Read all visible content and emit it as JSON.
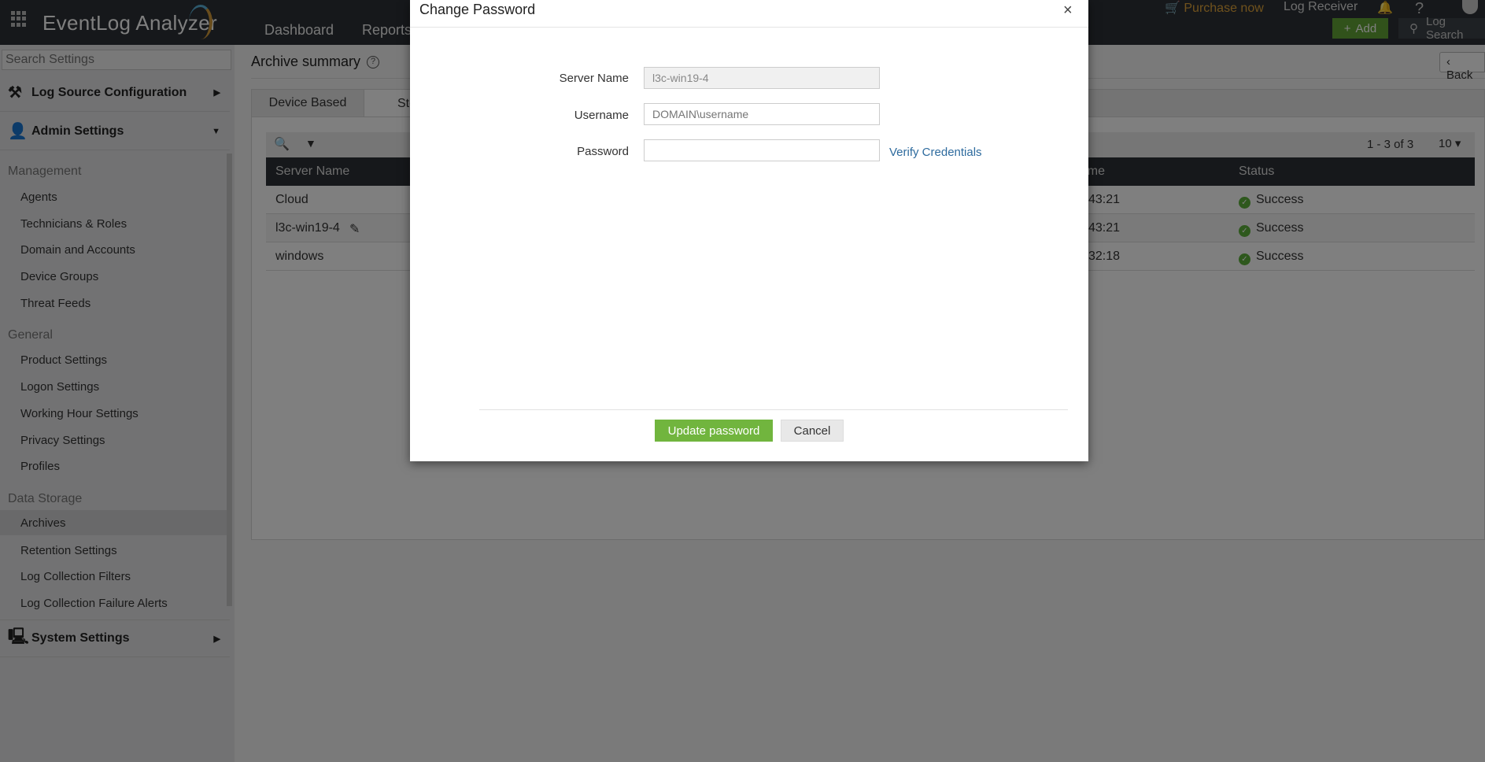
{
  "header": {
    "app_name": "EventLog Analyzer",
    "nav": [
      "Dashboard",
      "Reports"
    ],
    "purchase": "Purchase now",
    "log_receiver": "Log Receiver",
    "help": "?",
    "add": "Add",
    "log_search": "Log Search",
    "accent": "#62a536"
  },
  "sidebar": {
    "search_placeholder": "Search Settings",
    "log_source": "Log Source Configuration",
    "admin": "Admin Settings",
    "system": "System Settings",
    "sections": [
      {
        "title": "Management",
        "items": [
          "Agents",
          "Technicians & Roles",
          "Domain and Accounts",
          "Device Groups",
          "Threat Feeds"
        ]
      },
      {
        "title": "General",
        "items": [
          "Product Settings",
          "Logon Settings",
          "Working Hour Settings",
          "Privacy Settings",
          "Profiles"
        ]
      },
      {
        "title": "Data Storage",
        "items": [
          "Archives",
          "Retention Settings",
          "Log Collection Filters",
          "Log Collection Failure Alerts"
        ]
      }
    ],
    "active": "Archives"
  },
  "main": {
    "title": "Archive summary",
    "back": "Back",
    "tabs": [
      "Device Based",
      "Storage"
    ],
    "pagination": "1 - 3 of 3",
    "page_size": "10",
    "columns": [
      "Server Name",
      "Time",
      "Status"
    ],
    "rows": [
      {
        "server": "Cloud",
        "time": "43:21",
        "status": "Success"
      },
      {
        "server": "l3c-win19-4",
        "time": "43:21",
        "status": "Success"
      },
      {
        "server": "windows",
        "time": "32:18",
        "status": "Success"
      }
    ]
  },
  "modal": {
    "title": "Change Password",
    "server_label": "Server Name",
    "server_value": "l3c-win19-4",
    "username_label": "Username",
    "username_placeholder": "DOMAIN\\username",
    "password_label": "Password",
    "verify": "Verify Credentials",
    "update": "Update password",
    "cancel": "Cancel"
  }
}
